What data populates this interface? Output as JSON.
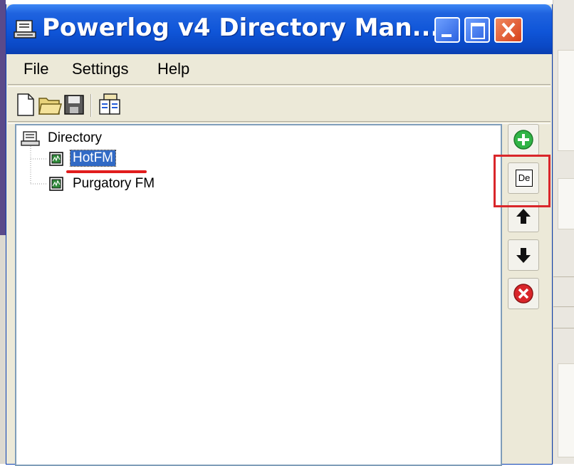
{
  "window": {
    "title": "Powerlog v4 Directory Man...",
    "title_icon": "directory-app-icon",
    "controls": {
      "minimize": "minimize-icon",
      "maximize": "maximize-icon",
      "close": "close-icon"
    }
  },
  "menu": [
    {
      "label": "File"
    },
    {
      "label": "Settings"
    },
    {
      "label": "Help"
    }
  ],
  "toolbar": [
    {
      "icon": "new-file-icon"
    },
    {
      "icon": "open-folder-icon"
    },
    {
      "icon": "save-disk-icon"
    },
    {
      "icon": "copy-pages-icon"
    }
  ],
  "tree": {
    "root": {
      "label": "Directory",
      "icon": "directory-book-icon"
    },
    "children": [
      {
        "label": "HotFM",
        "selected": true,
        "icon": "station-icon"
      },
      {
        "label": "Purgatory FM",
        "selected": false,
        "icon": "station-icon"
      }
    ]
  },
  "side_buttons": [
    {
      "icon": "add-green-icon"
    },
    {
      "icon": "de-icon",
      "text": "De",
      "highlighted": true
    },
    {
      "icon": "arrow-up-icon"
    },
    {
      "icon": "arrow-down-icon"
    },
    {
      "icon": "delete-red-icon"
    }
  ],
  "colors": {
    "titlebar": "#0f55d8",
    "selection": "#316ac5",
    "highlight": "#d9262a",
    "annotation_underline": "#e11d1d"
  }
}
